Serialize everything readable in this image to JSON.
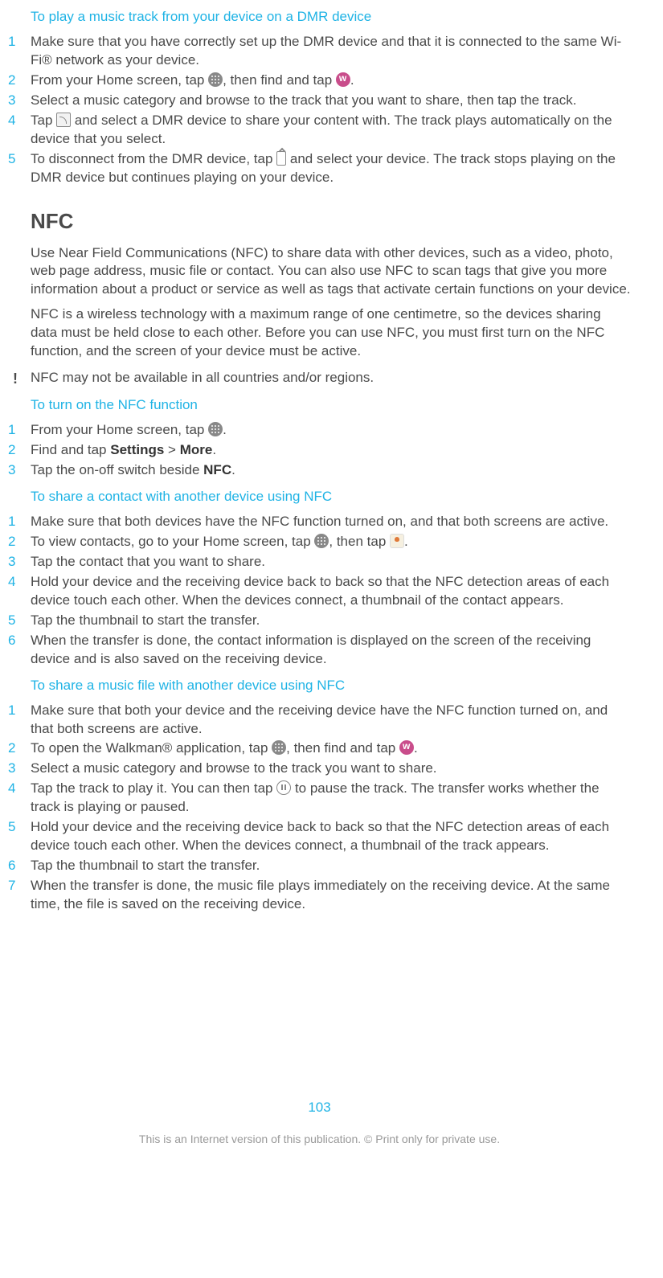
{
  "sec1": {
    "title": "To play a music track from your device on a DMR device",
    "steps": [
      {
        "pre": "Make sure that you have correctly set up the DMR device and that it is connected to the same Wi-Fi® network as your device."
      },
      {
        "pre": "From your Home screen, tap ",
        "icon1": "apps",
        "mid": ", then find and tap ",
        "icon2": "walkman",
        "post": "."
      },
      {
        "pre": "Select a music category and browse to the track that you want to share, then tap the track."
      },
      {
        "pre": "Tap ",
        "icon1": "cast",
        "post": " and select a DMR device to share your content with. The track plays automatically on the device that you select."
      },
      {
        "pre": "To disconnect from the DMR device, tap ",
        "icon1": "device",
        "post": " and select your device. The track stops playing on the DMR device but continues playing on your device."
      }
    ]
  },
  "nfc": {
    "heading": "NFC",
    "p1": "Use Near Field Communications (NFC) to share data with other devices, such as a video, photo, web page address, music file or contact. You can also use NFC to scan tags that give you more information about a product or service as well as tags that activate certain functions on your device.",
    "p2": "NFC is a wireless technology with a maximum range of one centimetre, so the devices sharing data must be held close to each other. Before you can use NFC, you must first turn on the NFC function, and the screen of your device must be active.",
    "note": "NFC may not be available in all countries and/or regions."
  },
  "sec2": {
    "title": "To turn on the NFC function",
    "steps": [
      {
        "pre": "From your Home screen, tap ",
        "icon1": "apps",
        "post": "."
      },
      {
        "pre": "Find and tap ",
        "b1": "Settings",
        "mid": " > ",
        "b2": "More",
        "post": "."
      },
      {
        "pre": "Tap the on-off switch beside ",
        "b1": "NFC",
        "post": "."
      }
    ]
  },
  "sec3": {
    "title": "To share a contact with another device using NFC",
    "steps": [
      {
        "pre": "Make sure that both devices have the NFC function turned on, and that both screens are active."
      },
      {
        "pre": "To view contacts, go to your Home screen, tap ",
        "icon1": "apps",
        "mid": ", then tap ",
        "icon2": "contacts",
        "post": "."
      },
      {
        "pre": "Tap the contact that you want to share."
      },
      {
        "pre": "Hold your device and the receiving device back to back so that the NFC detection areas of each device touch each other. When the devices connect, a thumbnail of the contact appears."
      },
      {
        "pre": "Tap the thumbnail to start the transfer."
      },
      {
        "pre": "When the transfer is done, the contact information is displayed on the screen of the receiving device and is also saved on the receiving device."
      }
    ]
  },
  "sec4": {
    "title": "To share a music file with another device using NFC",
    "steps": [
      {
        "pre": "Make sure that both your device and the receiving device have the NFC function turned on, and that both screens are active."
      },
      {
        "pre": "To open the Walkman® application, tap ",
        "icon1": "apps",
        "mid": ", then find and tap ",
        "icon2": "walkman",
        "post": "."
      },
      {
        "pre": "Select a music category and browse to the track you want to share."
      },
      {
        "pre": "Tap the track to play it. You can then tap ",
        "icon1": "pause",
        "post": " to pause the track. The transfer works whether the track is playing or paused."
      },
      {
        "pre": "Hold your device and the receiving device back to back so that the NFC detection areas of each device touch each other. When the devices connect, a thumbnail of the track appears."
      },
      {
        "pre": "Tap the thumbnail to start the transfer."
      },
      {
        "pre": "When the transfer is done, the music file plays immediately on the receiving device. At the same time, the file is saved on the receiving device."
      }
    ]
  },
  "pageNumber": "103",
  "footer": "This is an Internet version of this publication. © Print only for private use."
}
